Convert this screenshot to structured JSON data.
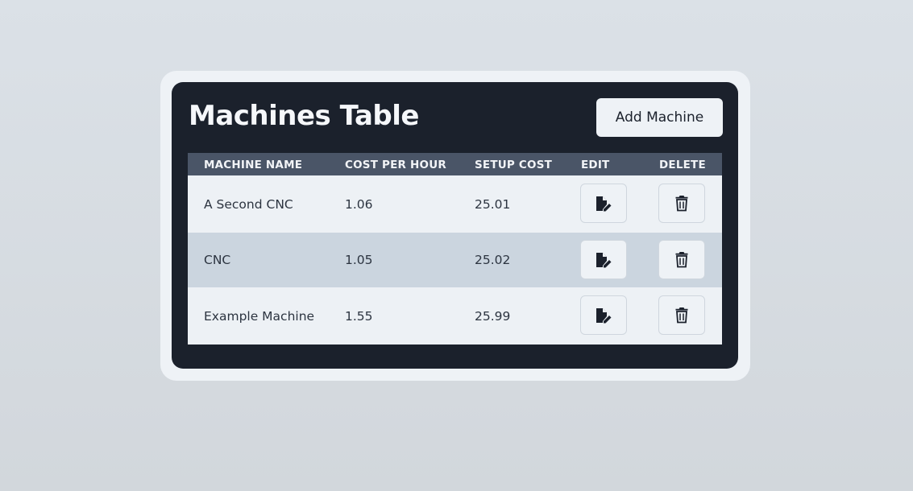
{
  "header": {
    "title": "Machines Table",
    "add_button_label": "Add Machine"
  },
  "table": {
    "columns": [
      "MACHINE NAME",
      "COST PER HOUR",
      "SETUP COST",
      "EDIT",
      "DELETE"
    ],
    "rows": [
      {
        "name": "A Second CNC",
        "cost_per_hour": "1.06",
        "setup_cost": "25.01"
      },
      {
        "name": "CNC",
        "cost_per_hour": "1.05",
        "setup_cost": "25.02"
      },
      {
        "name": "Example Machine",
        "cost_per_hour": "1.55",
        "setup_cost": "25.99"
      }
    ]
  },
  "icons": {
    "edit": "edit-document-icon",
    "delete": "trash-icon"
  },
  "colors": {
    "panel_bg": "#1b212c",
    "header_row_bg": "#4a5567",
    "row_light": "#edf1f5",
    "row_dark": "#cbd5df"
  }
}
